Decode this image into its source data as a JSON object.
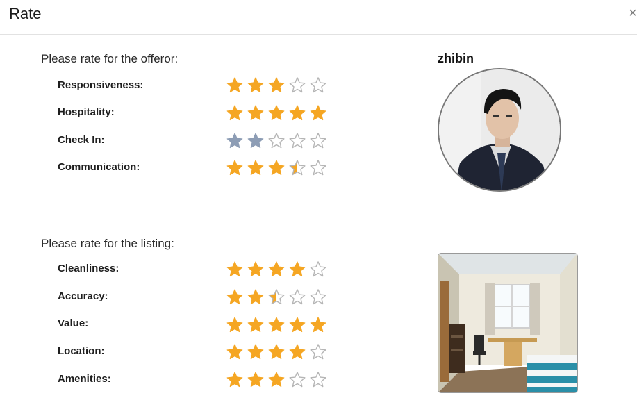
{
  "dialog": {
    "title": "Rate",
    "close_label": "×"
  },
  "offeror_section": {
    "heading": "Please rate for the offeror:",
    "username": "zhibin",
    "items": [
      {
        "label": "Responsiveness:",
        "rating": 3
      },
      {
        "label": "Hospitality:",
        "rating": 5
      },
      {
        "label": "Check In:",
        "rating": 2,
        "state": "hover"
      },
      {
        "label": "Communication:",
        "rating": 3.5
      }
    ]
  },
  "listing_section": {
    "heading": "Please rate for the listing:",
    "items": [
      {
        "label": "Cleanliness:",
        "rating": 4
      },
      {
        "label": "Accuracy:",
        "rating": 2.5
      },
      {
        "label": "Value:",
        "rating": 5
      },
      {
        "label": "Location:",
        "rating": 4
      },
      {
        "label": "Amenities:",
        "rating": 3
      }
    ]
  },
  "star_max": 5,
  "colors": {
    "star_filled": "#f5a623",
    "star_hover": "#8d9db5",
    "star_empty_stroke": "#b5b5b5"
  },
  "icons": {
    "star": "star-icon",
    "close": "close-icon"
  }
}
